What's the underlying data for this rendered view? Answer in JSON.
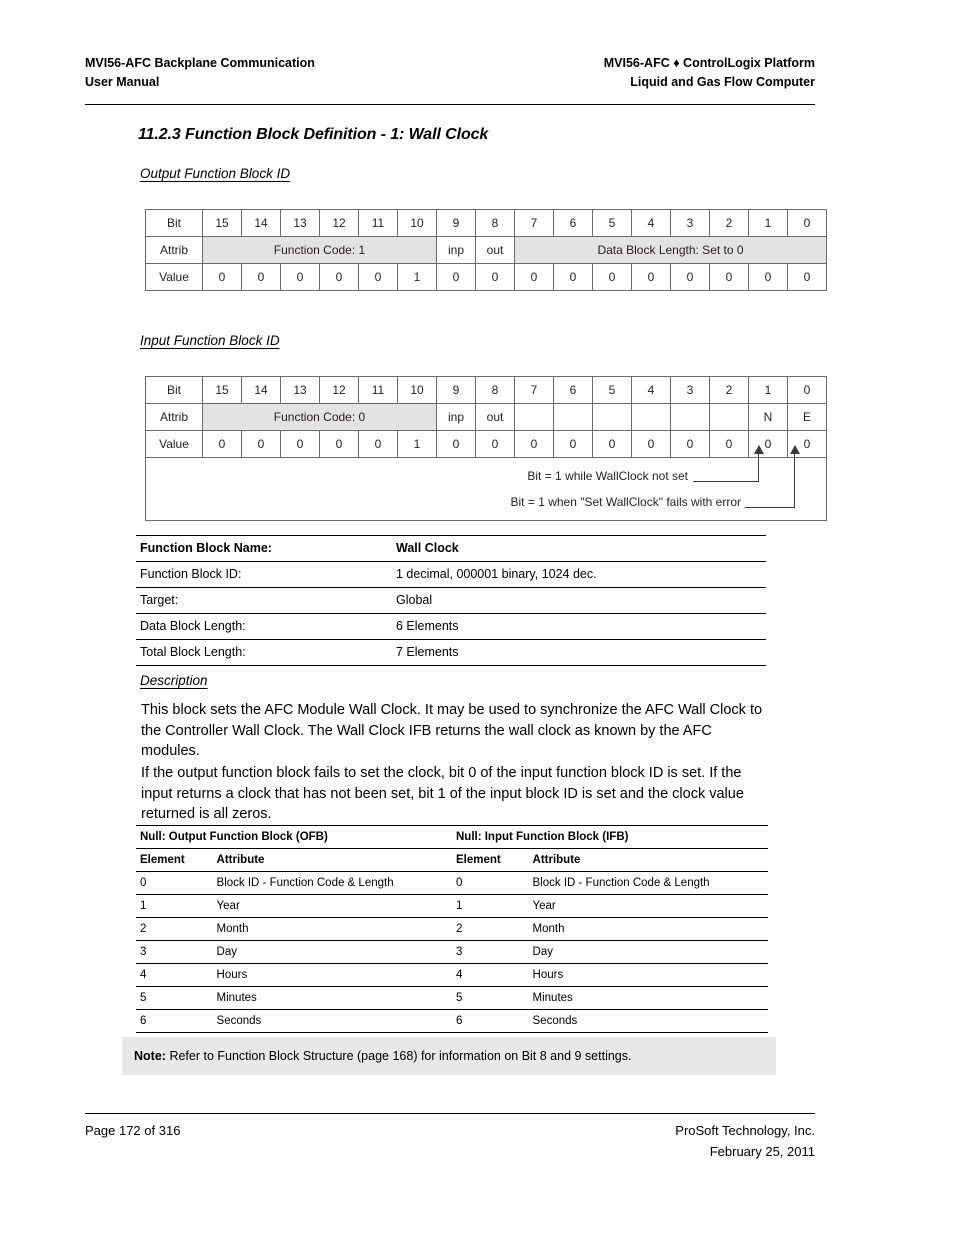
{
  "header": {
    "left_line1": "MVI56-AFC Backplane Communication",
    "left_line2": "User Manual",
    "right_line1": "MVI56-AFC ♦ ControlLogix Platform",
    "right_line2": "Liquid and Gas Flow Computer"
  },
  "section": {
    "heading": "11.2.3 Function Block Definition - 1: Wall Clock",
    "output_fb_label": "Output Function Block ID",
    "input_fb_label": "Input Function Block ID",
    "description_label": "Description"
  },
  "output_bit_table": {
    "row_labels": {
      "bit": "Bit",
      "attrib": "Attrib",
      "value": "Value"
    },
    "bits": [
      "15",
      "14",
      "13",
      "12",
      "11",
      "10",
      "9",
      "8",
      "7",
      "6",
      "5",
      "4",
      "3",
      "2",
      "1",
      "0"
    ],
    "attrib_groups": [
      {
        "label": "Function Code: 1",
        "span": 6,
        "shaded": true
      },
      {
        "label": "inp",
        "span": 1,
        "shaded": false
      },
      {
        "label": "out",
        "span": 1,
        "shaded": false
      },
      {
        "label": "Data Block Length: Set to 0",
        "span": 8,
        "shaded": true
      }
    ],
    "values": [
      "0",
      "0",
      "0",
      "0",
      "0",
      "1",
      "0",
      "0",
      "0",
      "0",
      "0",
      "0",
      "0",
      "0",
      "0",
      "0"
    ]
  },
  "input_bit_table": {
    "row_labels": {
      "bit": "Bit",
      "attrib": "Attrib",
      "value": "Value"
    },
    "bits": [
      "15",
      "14",
      "13",
      "12",
      "11",
      "10",
      "9",
      "8",
      "7",
      "6",
      "5",
      "4",
      "3",
      "2",
      "1",
      "0"
    ],
    "attrib_groups": [
      {
        "label": "Function Code: 0",
        "span": 6,
        "shaded": true
      },
      {
        "label": "inp",
        "span": 1,
        "shaded": false
      },
      {
        "label": "out",
        "span": 1,
        "shaded": false
      },
      {
        "label": "",
        "span": 1,
        "shaded": false
      },
      {
        "label": "",
        "span": 1,
        "shaded": false
      },
      {
        "label": "",
        "span": 1,
        "shaded": false
      },
      {
        "label": "",
        "span": 1,
        "shaded": false
      },
      {
        "label": "",
        "span": 1,
        "shaded": false
      },
      {
        "label": "",
        "span": 1,
        "shaded": false
      },
      {
        "label": "N",
        "span": 1,
        "shaded": false
      },
      {
        "label": "E",
        "span": 1,
        "shaded": false
      }
    ],
    "values": [
      "0",
      "0",
      "0",
      "0",
      "0",
      "1",
      "0",
      "0",
      "0",
      "0",
      "0",
      "0",
      "0",
      "0",
      "0",
      "0"
    ],
    "annotations": {
      "note_bit1": "Bit = 1 while WallClock not set",
      "note_bit0": "Bit = 1 when \"Set WallClock\" fails with error"
    }
  },
  "spec_table": {
    "rows": [
      {
        "key": "Function Block Name:",
        "value": "Wall Clock"
      },
      {
        "key": "Function Block ID:",
        "value": "1 decimal, 000001 binary, 1024 dec."
      },
      {
        "key": "Target:",
        "value": "Global"
      },
      {
        "key": "Data Block Length:",
        "value": "6 Elements"
      },
      {
        "key": "Total Block Length:",
        "value": "7 Elements"
      }
    ]
  },
  "description": {
    "paragraph_1": "This block sets the AFC Module Wall Clock. It may be used to synchronize the AFC Wall Clock to the Controller Wall Clock. The Wall Clock IFB returns the wall clock as known by the AFC modules.",
    "paragraph_2": "If the output function block fails to set the clock, bit 0 of the input function block ID is set. If the input returns a clock that has not been set, bit 1 of the input block ID is set and the clock value returned is all zeros."
  },
  "element_table": {
    "group_headers": {
      "ofb": "Null: Output Function Block (OFB)",
      "ifb": "Null: Input Function Block (IFB)"
    },
    "column_headers": {
      "element_left": "Element",
      "attribute_left": "Attribute",
      "element_right": "Element",
      "attribute_right": "Attribute"
    },
    "rows": [
      {
        "ofb_element": "0",
        "ofb_attribute": "Block ID - Function Code & Length",
        "ifb_element": "0",
        "ifb_attribute": "Block ID - Function Code & Length"
      },
      {
        "ofb_element": "1",
        "ofb_attribute": "Year",
        "ifb_element": "1",
        "ifb_attribute": "Year"
      },
      {
        "ofb_element": "2",
        "ofb_attribute": "Month",
        "ifb_element": "2",
        "ifb_attribute": "Month"
      },
      {
        "ofb_element": "3",
        "ofb_attribute": "Day",
        "ifb_element": "3",
        "ifb_attribute": "Day"
      },
      {
        "ofb_element": "4",
        "ofb_attribute": "Hours",
        "ifb_element": "4",
        "ifb_attribute": "Hours"
      },
      {
        "ofb_element": "5",
        "ofb_attribute": "Minutes",
        "ifb_element": "5",
        "ifb_attribute": "Minutes"
      },
      {
        "ofb_element": "6",
        "ofb_attribute": "Seconds",
        "ifb_element": "6",
        "ifb_attribute": "Seconds"
      }
    ]
  },
  "note": {
    "label": "Note:",
    "text": "Refer to Function Block Structure (page 168) for information on Bit 8 and 9 settings."
  },
  "footer": {
    "page": "Page 172 of 316",
    "company": "ProSoft Technology, Inc.",
    "date": "February 25, 2011"
  },
  "colors": {
    "shade": "#e3e3e3",
    "note_background": "#e8e8e8",
    "table_border": "#6b6b6b",
    "text": "#231f20"
  }
}
